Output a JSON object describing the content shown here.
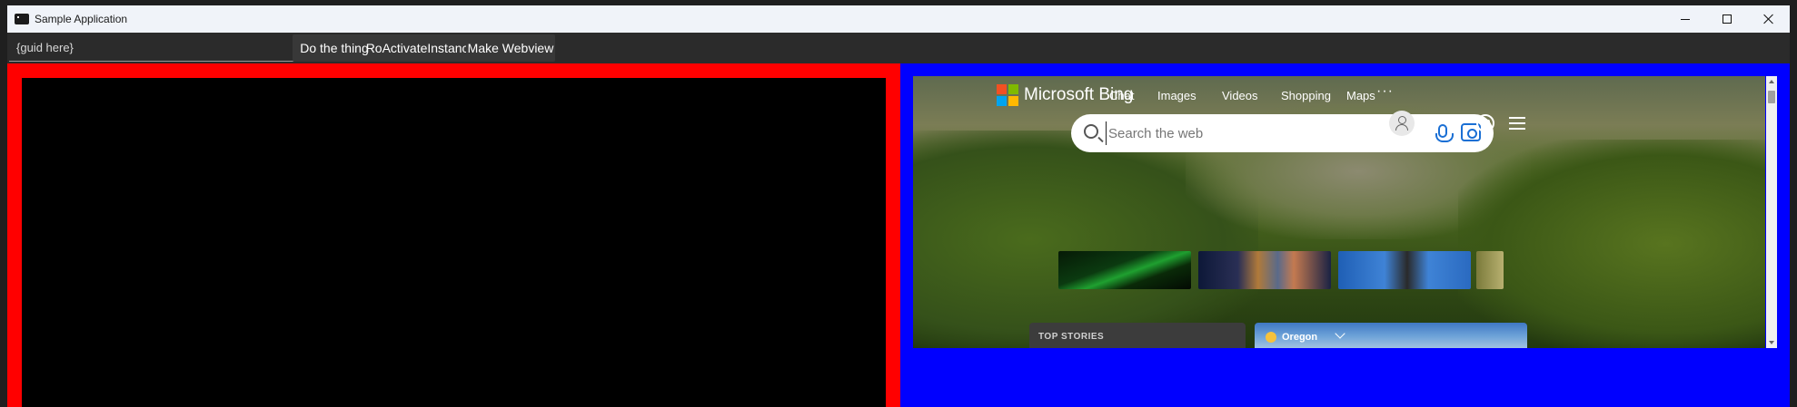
{
  "window": {
    "title": "Sample Application",
    "controls": {
      "minimize": "minimize",
      "maximize": "maximize",
      "close": "close"
    }
  },
  "toolbar": {
    "guid_value": "{guid here}",
    "buttons": [
      "Do the thing",
      "RoActivateInstance",
      "Make Webview"
    ]
  },
  "panes": {
    "left_color": "#ff0000",
    "surface_color": "#000000",
    "right_color": "#0000ff"
  },
  "webview": {
    "brand": "Microsoft Bing",
    "nav": [
      "Chat",
      "Images",
      "Videos",
      "Shopping",
      "Maps"
    ],
    "nav_more": "···",
    "search_placeholder": "Search the web",
    "top_stories_label": "TOP STORIES",
    "weather_location": "Oregon"
  },
  "icons": [
    "app-icon",
    "search-icon",
    "mic-icon",
    "visual-search-icon",
    "profile-icon",
    "rewards-icon",
    "menu-icon",
    "sun-icon",
    "chevron-down-icon"
  ]
}
